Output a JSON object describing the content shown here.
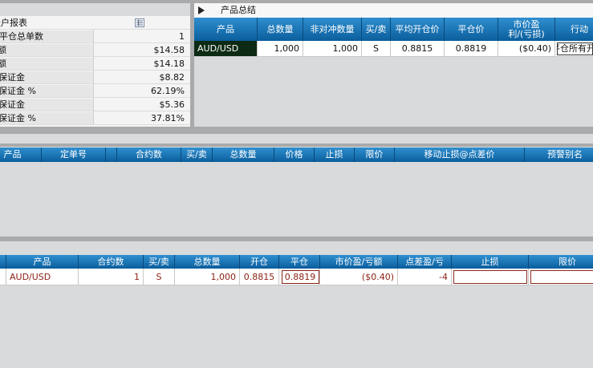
{
  "account_panel": {
    "header_label": "账户报表",
    "rows": [
      {
        "label": "未平仓总单数",
        "value": "1"
      },
      {
        "label": "账户余额",
        "value": "$14.58"
      },
      {
        "label": "可用余额",
        "value": "$14.18"
      },
      {
        "label": "已用保证金",
        "value": "$8.82"
      },
      {
        "label": "已用保证金 %",
        "value": "62.19%"
      },
      {
        "label": "可用保证金",
        "value": "$5.36"
      },
      {
        "label": "可用保证金 %",
        "value": "37.81%"
      }
    ]
  },
  "product_summary": {
    "title": "产品总结",
    "columns": [
      "产品",
      "总数量",
      "非对冲数量",
      "买/卖",
      "平均开仓价",
      "平仓价",
      "市价盈利/(亏损)",
      "行动"
    ],
    "rows": [
      {
        "product": "AUD/USD",
        "total_qty": "1,000",
        "unhedged_qty": "1,000",
        "side": "S",
        "avg_open": "0.8815",
        "close_price": "0.8819",
        "pnl": "($0.40)",
        "action": "平仓所有开仓"
      }
    ]
  },
  "orders_table": {
    "columns": [
      "产品",
      "定单号",
      "合约数",
      "买/卖",
      "总数量",
      "价格",
      "止损",
      "限价",
      "移动止损@点差价",
      "预警别名"
    ]
  },
  "positions_table": {
    "columns": [
      "产品",
      "合约数",
      "买/卖",
      "总数量",
      "开仓",
      "平仓",
      "市价盈/亏额",
      "点差盈/亏",
      "止损",
      "限价"
    ],
    "rows": [
      {
        "product": "AUD/USD",
        "contracts": "1",
        "side": "S",
        "total_qty": "1,000",
        "open": "0.8815",
        "close": "0.8819",
        "pnl": "($0.40)",
        "pip_pnl": "-4",
        "stop": "",
        "limit": ""
      }
    ]
  },
  "colors": {
    "header_blue": "#0b5e9c",
    "accent_red": "#8a1f12",
    "dark_cell": "#0d2a14"
  }
}
